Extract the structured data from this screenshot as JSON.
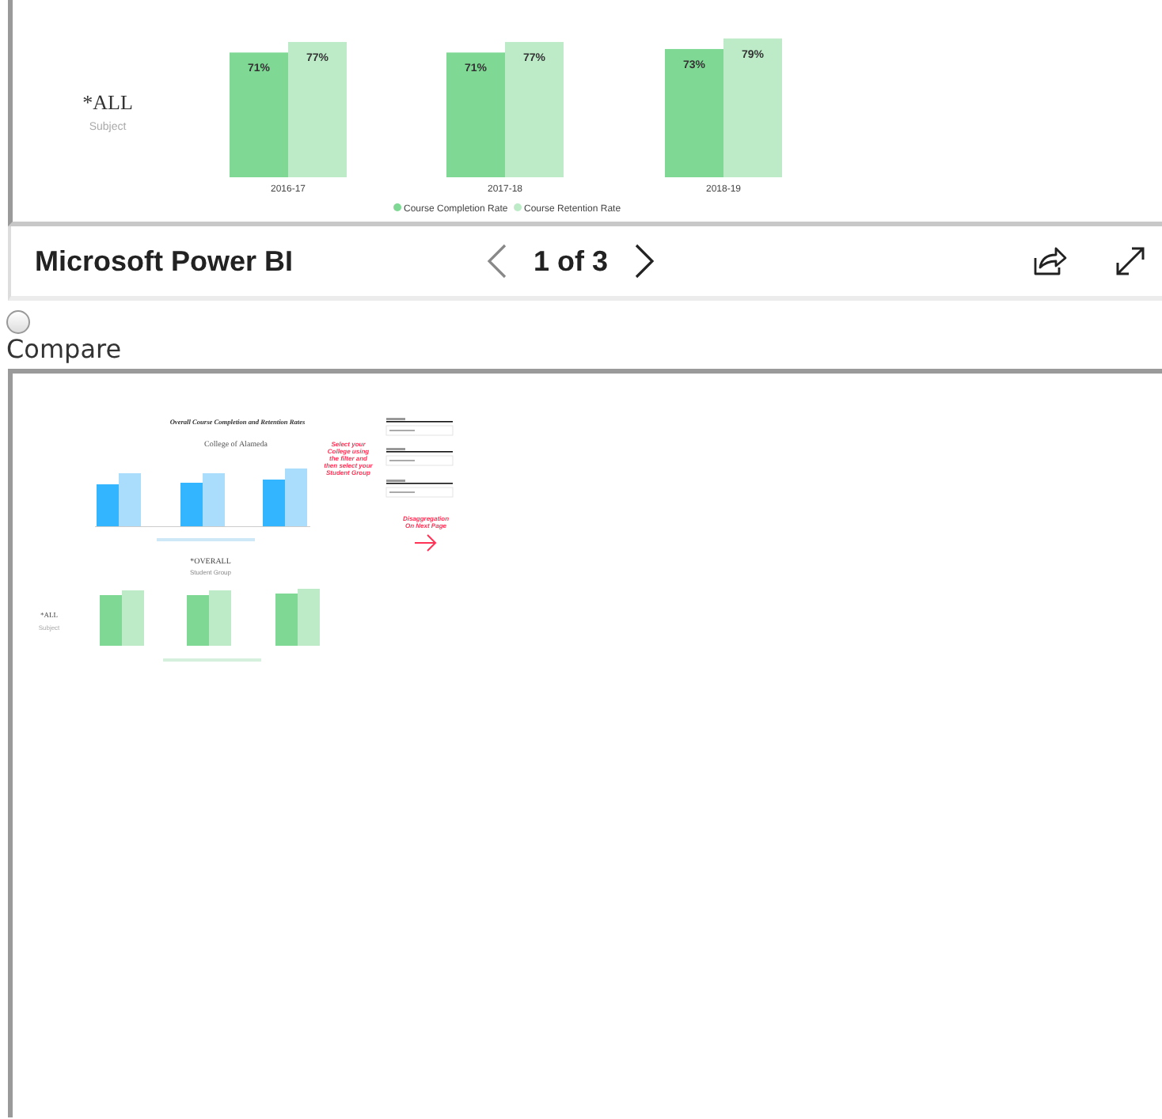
{
  "report_visual": {
    "subject_value": "*ALL",
    "subject_label": "Subject",
    "chart_data": {
      "type": "bar",
      "categories": [
        "2016-17",
        "2017-18",
        "2018-19"
      ],
      "legend": true,
      "series": [
        {
          "name": "Course Completion Rate",
          "color": "#7fd894",
          "values": [
            71,
            71,
            73
          ],
          "value_labels": [
            "71%",
            "71%",
            "73%"
          ]
        },
        {
          "name": "Course Retention Rate",
          "color": "#bdebc8",
          "values": [
            77,
            77,
            79
          ],
          "value_labels": [
            "77%",
            "77%",
            "79%"
          ]
        }
      ]
    }
  },
  "footer": {
    "title": "Microsoft Power BI",
    "page_indicator": "1 of 3"
  },
  "compare": {
    "label": "Compare",
    "checked": false
  },
  "thumbnail": {
    "title": "Overall Course Completion and Retention Rates",
    "college": "College of Alameda",
    "instruction_lines": [
      "Select your",
      "College using",
      "the filter and",
      "then select your",
      "Student Group"
    ],
    "next_page_lines": [
      "Disaggregation",
      "On Next Page"
    ],
    "group_value": "*OVERALL",
    "group_label": "Student Group",
    "subject_value": "*ALL",
    "subject_label": "Subject"
  }
}
